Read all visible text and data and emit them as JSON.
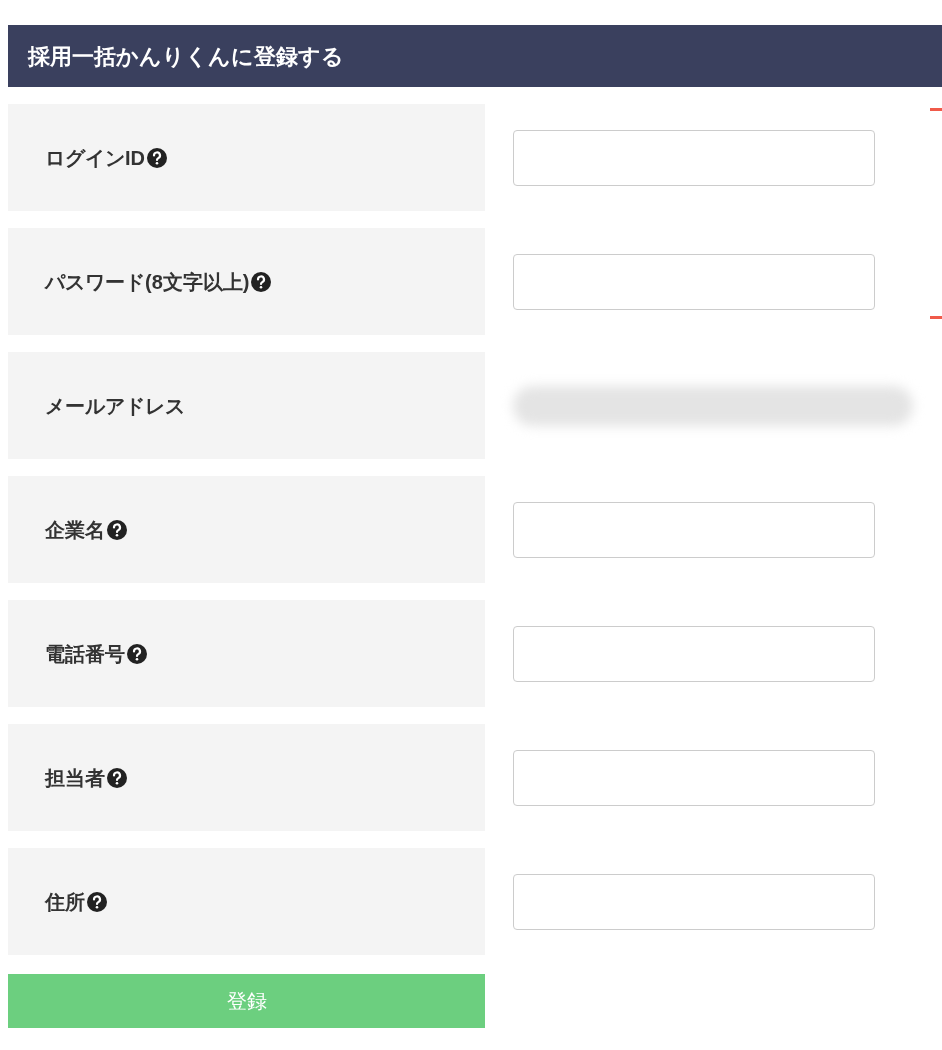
{
  "title": "採用一括かんりくんに登録する",
  "fields": [
    {
      "label": "ログインID",
      "help": true,
      "kind": "input"
    },
    {
      "label": "パスワード(8文字以上)",
      "help": true,
      "kind": "input"
    },
    {
      "label": "メールアドレス",
      "help": false,
      "kind": "redacted"
    },
    {
      "label": "企業名",
      "help": true,
      "kind": "input"
    },
    {
      "label": "電話番号",
      "help": true,
      "kind": "input"
    },
    {
      "label": "担当者",
      "help": true,
      "kind": "input"
    },
    {
      "label": "住所",
      "help": true,
      "kind": "input"
    }
  ],
  "submit": {
    "label": "登録"
  }
}
